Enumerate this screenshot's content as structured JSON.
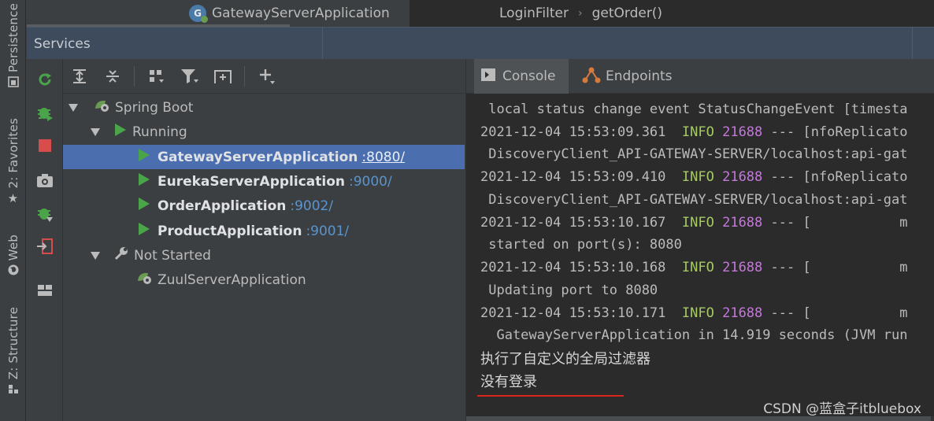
{
  "left_strip": {
    "tabs": [
      {
        "label": "Persistence",
        "icon": "persistence-icon"
      },
      {
        "label": "2: Favorites",
        "icon": "star-icon"
      },
      {
        "label": "Web",
        "icon": "globe-icon"
      },
      {
        "label": "Z: Structure",
        "icon": "structure-icon"
      }
    ]
  },
  "editor": {
    "tab_title": "GatewayServerApplication",
    "breadcrumb": [
      "LoginFilter",
      "getOrder()"
    ]
  },
  "services": {
    "title": "Services",
    "actions": [
      "rerun-icon",
      "debug-icon",
      "stop-icon",
      "camera-icon",
      "debug-attach-icon",
      "login-icon",
      "layout-icon"
    ],
    "toolbar": [
      "expand-all-icon",
      "collapse-all-icon",
      "group-icon",
      "filter-icon",
      "new-tab-icon",
      "add-icon"
    ],
    "tree": [
      {
        "label": "Spring Boot",
        "level": 0,
        "expanded": true,
        "type": "group"
      },
      {
        "label": "Running",
        "level": 1,
        "expanded": true,
        "type": "status"
      },
      {
        "label": "GatewayServerApplication",
        "port": ":8080/",
        "level": 2,
        "selected": true,
        "type": "app"
      },
      {
        "label": "EurekaServerApplication",
        "port": ":9000/",
        "level": 2,
        "type": "app"
      },
      {
        "label": "OrderApplication",
        "port": ":9002/",
        "level": 2,
        "type": "app"
      },
      {
        "label": "ProductApplication",
        "port": ":9001/",
        "level": 2,
        "type": "app"
      },
      {
        "label": "Not Started",
        "level": 1,
        "expanded": true,
        "type": "status"
      },
      {
        "label": "ZuulServerApplication",
        "level": 2,
        "type": "stopped-app"
      }
    ]
  },
  "console": {
    "tabs": [
      {
        "label": "Console",
        "active": true
      },
      {
        "label": "Endpoints",
        "active": false
      }
    ],
    "lines": [
      {
        "text": " local status change event StatusChangeEvent [timesta"
      },
      {
        "ts": "2021-12-04 15:53:09.361",
        "level": "INFO",
        "pid": "21688",
        "rest": " --- [nfoReplicato"
      },
      {
        "text": " DiscoveryClient_API-GATEWAY-SERVER/localhost:api-gat"
      },
      {
        "ts": "2021-12-04 15:53:09.410",
        "level": "INFO",
        "pid": "21688",
        "rest": " --- [nfoReplicato"
      },
      {
        "text": " DiscoveryClient_API-GATEWAY-SERVER/localhost:api-gat"
      },
      {
        "ts": "2021-12-04 15:53:10.167",
        "level": "INFO",
        "pid": "21688",
        "rest": " --- [           m"
      },
      {
        "text": " started on port(s): 8080"
      },
      {
        "ts": "2021-12-04 15:53:10.168",
        "level": "INFO",
        "pid": "21688",
        "rest": " --- [           m"
      },
      {
        "text": " Updating port to 8080"
      },
      {
        "ts": "2021-12-04 15:53:10.171",
        "level": "INFO",
        "pid": "21688",
        "rest": " --- [           m"
      },
      {
        "text": "  GatewayServerApplication in 14.919 seconds (JVM run"
      }
    ],
    "message1": "执行了自定义的全局过滤器",
    "message2": "没有登录",
    "watermark": "CSDN @蓝盒子itbluebox"
  },
  "colors": {
    "info": "#a6c964",
    "pid": "#c678dd",
    "link": "#5994ce",
    "selection": "#4b6eaf",
    "run_green": "#4aa54a",
    "underline_red": "#d9261c"
  }
}
